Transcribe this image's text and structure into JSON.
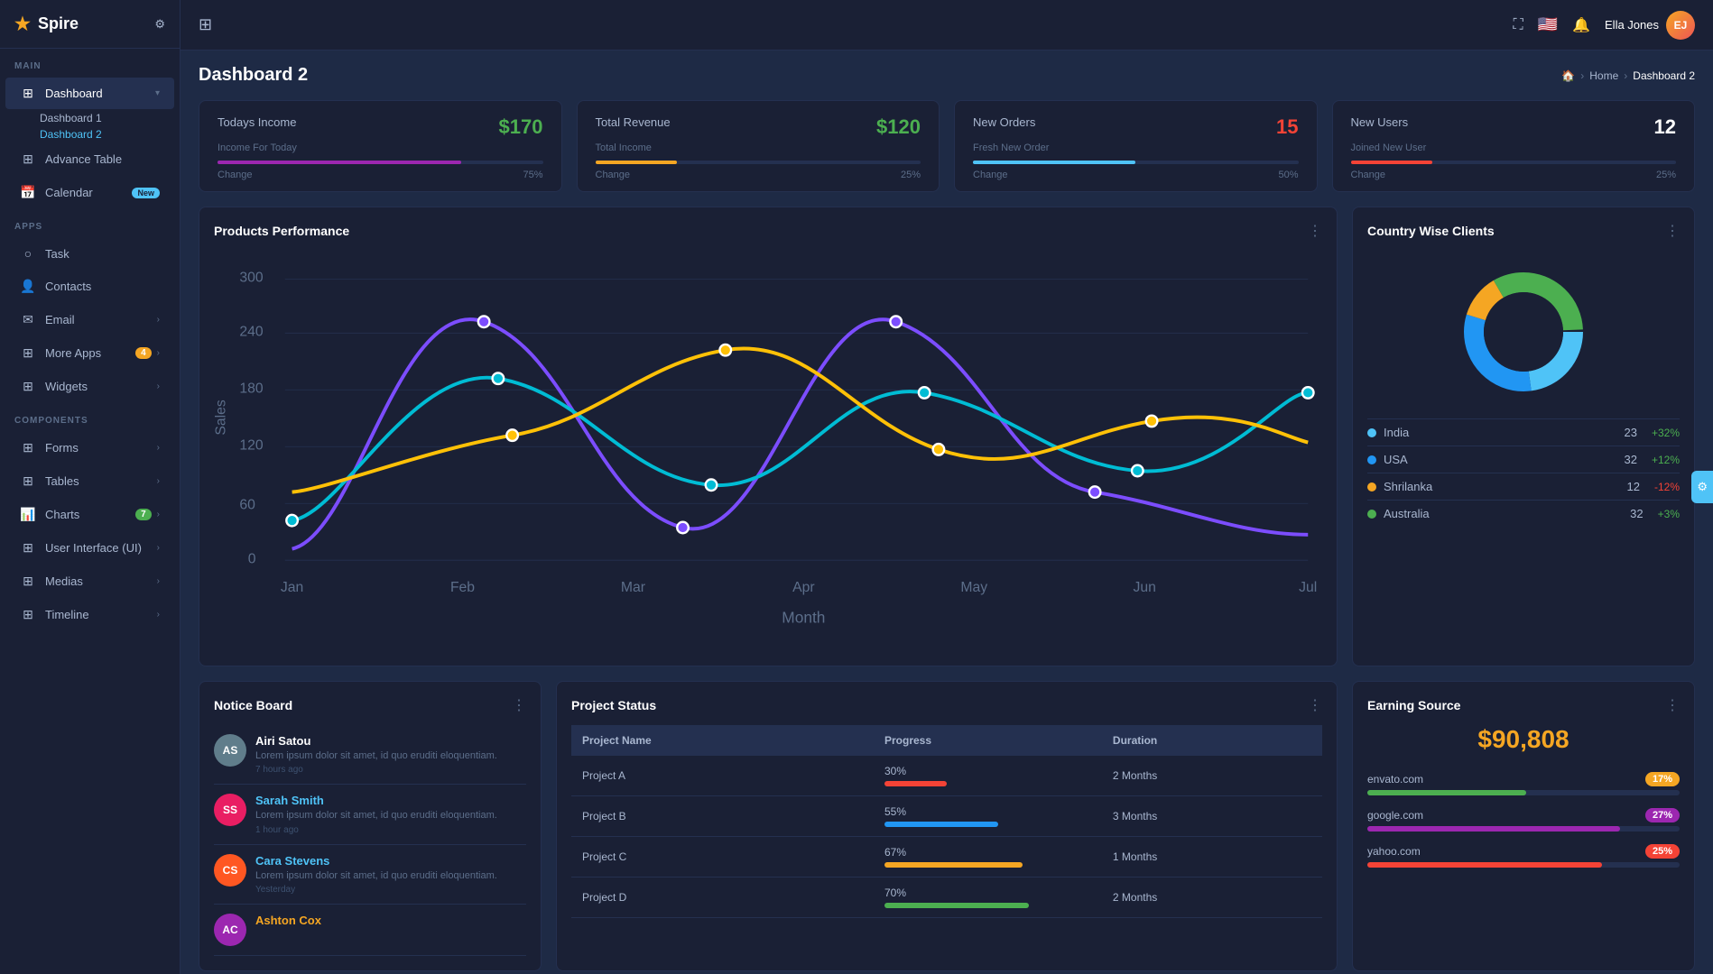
{
  "app": {
    "name": "Spire"
  },
  "sidebar": {
    "sections": [
      {
        "label": "MAIN",
        "items": [
          {
            "id": "dashboard",
            "icon": "⊞",
            "label": "Dashboard",
            "chevron": true,
            "badge": null
          },
          {
            "id": "dashboard1",
            "label": "Dashboard 1",
            "sub": true
          },
          {
            "id": "dashboard2",
            "label": "Dashboard 2",
            "sub": true,
            "active": true
          }
        ]
      },
      {
        "label": "APPS",
        "items": [
          {
            "id": "advance-table",
            "icon": "⊞",
            "label": "Advance Table"
          },
          {
            "id": "calendar",
            "icon": "📅",
            "label": "Calendar",
            "badge": "New",
            "badgeType": "new"
          },
          {
            "id": "task",
            "icon": "○",
            "label": "Task"
          },
          {
            "id": "contacts",
            "icon": "👤",
            "label": "Contacts"
          },
          {
            "id": "email",
            "icon": "✉",
            "label": "Email",
            "chevron": true
          },
          {
            "id": "more-apps",
            "icon": "⊞",
            "label": "More Apps",
            "chevron": true,
            "badge": "4",
            "badgeType": "orange"
          },
          {
            "id": "widgets",
            "icon": "⊞",
            "label": "Widgets",
            "chevron": true
          }
        ]
      },
      {
        "label": "COMPONENTS",
        "items": [
          {
            "id": "forms",
            "icon": "⊞",
            "label": "Forms",
            "chevron": true
          },
          {
            "id": "tables",
            "icon": "⊞",
            "label": "Tables",
            "chevron": true
          },
          {
            "id": "charts",
            "icon": "📊",
            "label": "Charts",
            "chevron": true,
            "badge": "7",
            "badgeType": "green"
          },
          {
            "id": "ui",
            "icon": "⊞",
            "label": "User Interface (UI)",
            "chevron": true
          },
          {
            "id": "medias",
            "icon": "⊞",
            "label": "Medias",
            "chevron": true
          },
          {
            "id": "timeline",
            "icon": "⊞",
            "label": "Timeline",
            "chevron": true
          }
        ]
      }
    ]
  },
  "topbar": {
    "username": "Ella Jones",
    "avatar_initials": "EJ"
  },
  "page": {
    "title": "Dashboard 2",
    "breadcrumb": [
      "Home",
      "Dashboard 2"
    ]
  },
  "stats": [
    {
      "title": "Todays Income",
      "subtitle": "Income For Today",
      "value": "$170",
      "color": "green",
      "progress": 75,
      "progress_color": "#9c27b0",
      "change_label": "Change",
      "change_pct": "75%"
    },
    {
      "title": "Total Revenue",
      "subtitle": "Total Income",
      "value": "$120",
      "color": "green",
      "progress": 25,
      "progress_color": "#f5a623",
      "change_label": "Change",
      "change_pct": "25%"
    },
    {
      "title": "New Orders",
      "subtitle": "Fresh New Order",
      "value": "15",
      "color": "red",
      "progress": 50,
      "progress_color": "#4fc3f7",
      "change_label": "Change",
      "change_pct": "50%"
    },
    {
      "title": "New Users",
      "subtitle": "Joined New User",
      "value": "12",
      "color": "white",
      "progress": 25,
      "progress_color": "#f44336",
      "change_label": "Change",
      "change_pct": "25%"
    }
  ],
  "products_performance": {
    "title": "Products Performance",
    "x_labels": [
      "Jan",
      "Feb",
      "Mar",
      "Apr",
      "May",
      "Jun",
      "Jul"
    ],
    "y_labels": [
      "300",
      "240",
      "180",
      "120",
      "60",
      "0"
    ],
    "y_label": "Sales",
    "x_label": "Month"
  },
  "country_wise": {
    "title": "Country Wise Clients",
    "countries": [
      {
        "name": "India",
        "count": 23,
        "change": "+32%",
        "pos": true,
        "color": "#4fc3f7"
      },
      {
        "name": "USA",
        "count": 32,
        "change": "+12%",
        "pos": true,
        "color": "#2196f3"
      },
      {
        "name": "Shrilanka",
        "count": 12,
        "change": "-12%",
        "pos": false,
        "color": "#f5a623"
      },
      {
        "name": "Australia",
        "count": 32,
        "change": "+3%",
        "pos": true,
        "color": "#4caf50"
      }
    ]
  },
  "notice_board": {
    "title": "Notice Board",
    "items": [
      {
        "name": "Airi Satou",
        "color": "#607d8b",
        "initials": "AS",
        "text": "Lorem ipsum dolor sit amet, id quo eruditi eloquentiam.",
        "time": "7 hours ago",
        "name_color": "#fff"
      },
      {
        "name": "Sarah Smith",
        "color": "#e91e63",
        "initials": "SS",
        "text": "Lorem ipsum dolor sit amet, id quo eruditi eloquentiam.",
        "time": "1 hour ago",
        "name_color": "#4fc3f7"
      },
      {
        "name": "Cara Stevens",
        "color": "#ff5722",
        "initials": "CS",
        "text": "Lorem ipsum dolor sit amet, id quo eruditi eloquentiam.",
        "time": "Yesterday",
        "name_color": "#4fc3f7"
      },
      {
        "name": "Ashton Cox",
        "color": "#9c27b0",
        "initials": "AC",
        "text": "",
        "time": "",
        "name_color": "#f5a623"
      }
    ]
  },
  "project_status": {
    "title": "Project Status",
    "columns": [
      "Project Name",
      "Progress",
      "Duration"
    ],
    "rows": [
      {
        "name": "Project A",
        "progress": 30,
        "progress_color": "#f44336",
        "duration": "2 Months"
      },
      {
        "name": "Project B",
        "progress": 55,
        "progress_color": "#2196f3",
        "duration": "3 Months"
      },
      {
        "name": "Project C",
        "progress": 67,
        "progress_color": "#f5a623",
        "duration": "1 Months"
      },
      {
        "name": "Project D",
        "progress": 70,
        "progress_color": "#4caf50",
        "duration": "2 Months"
      }
    ]
  },
  "earning_source": {
    "title": "Earning Source",
    "total": "$90,808",
    "items": [
      {
        "site": "envato.com",
        "pct": 17,
        "bar_color": "#4caf50",
        "badge_color": "#f5a623"
      },
      {
        "site": "google.com",
        "pct": 27,
        "bar_color": "#9c27b0",
        "badge_color": "#9c27b0"
      },
      {
        "site": "yahoo.com",
        "pct": 25,
        "bar_color": "#f44336",
        "badge_color": "#f44336"
      }
    ]
  }
}
